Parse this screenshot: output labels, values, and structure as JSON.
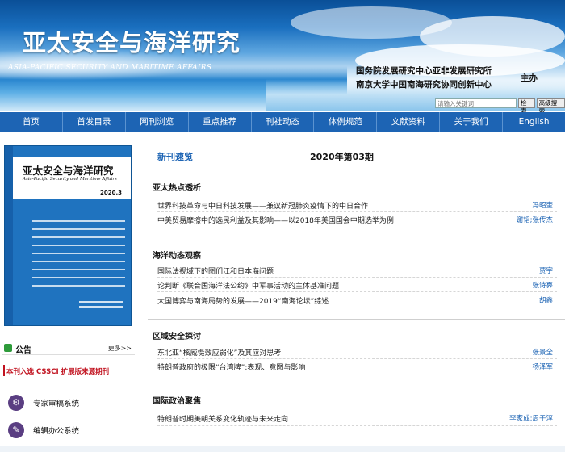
{
  "header": {
    "title_cn": "亚太安全与海洋研究",
    "title_en": "ASIA-PACIFIC SECURITY AND MARITIME AFFAIRS",
    "orgs": [
      "国务院发展研究中心亚非发展研究所",
      "南京大学中国南海研究协同创新中心"
    ],
    "host_label": "主办",
    "search_placeholder": "请输入关键词",
    "search_button": "检索",
    "advanced_search_button": "高级搜索"
  },
  "nav": {
    "items": [
      "首页",
      "首发目录",
      "网刊浏览",
      "重点推荐",
      "刊社动态",
      "体例规范",
      "文献资料",
      "关于我们",
      "English"
    ]
  },
  "left": {
    "cover": {
      "title": "亚太安全与海洋研究",
      "subtitle": "Asia-Pacific Security and Maritime Affairs",
      "issue": "2020.3"
    },
    "notice": {
      "label": "公告",
      "more": "更多>>",
      "item": "本刊入选 CSSCI 扩展版来源期刊"
    },
    "systems": [
      "专家审稿系统",
      "编辑办公系统"
    ]
  },
  "main": {
    "section_title": "新刊速览",
    "issue": "2020年第03期",
    "categories": [
      {
        "name": "亚太热点透析",
        "articles": [
          {
            "title": "世界科技革命与中日科技发展——兼议新冠肺炎疫情下的中日合作",
            "author": "冯昭奎"
          },
          {
            "title": "中美贸易摩擦中的选民利益及其影响——以2018年美国国会中期选举为例",
            "author": "谢韬;张传杰"
          }
        ]
      },
      {
        "name": "海洋动态观察",
        "articles": [
          {
            "title": "国际法视域下的图们江和日本海问题",
            "author": "贾宇"
          },
          {
            "title": "论判断《联合国海洋法公约》中军事活动的主体基准问题",
            "author": "张诗奡"
          },
          {
            "title": "大国博弈与南海局势的发展——2019“南海论坛”综述",
            "author": "胡鑫"
          }
        ]
      },
      {
        "name": "区域安全探讨",
        "articles": [
          {
            "title": "东北亚“核威慑效应弱化”及其应对思考",
            "author": "张景全"
          },
          {
            "title": "特朗普政府的极限“台湾牌”:表现、意图与影响",
            "author": "杨泽军"
          }
        ]
      },
      {
        "name": "国际政治聚焦",
        "articles": [
          {
            "title": "特朗普时期美朝关系变化轨迹与未来走向",
            "author": "李家成;周子淳"
          }
        ]
      }
    ]
  }
}
